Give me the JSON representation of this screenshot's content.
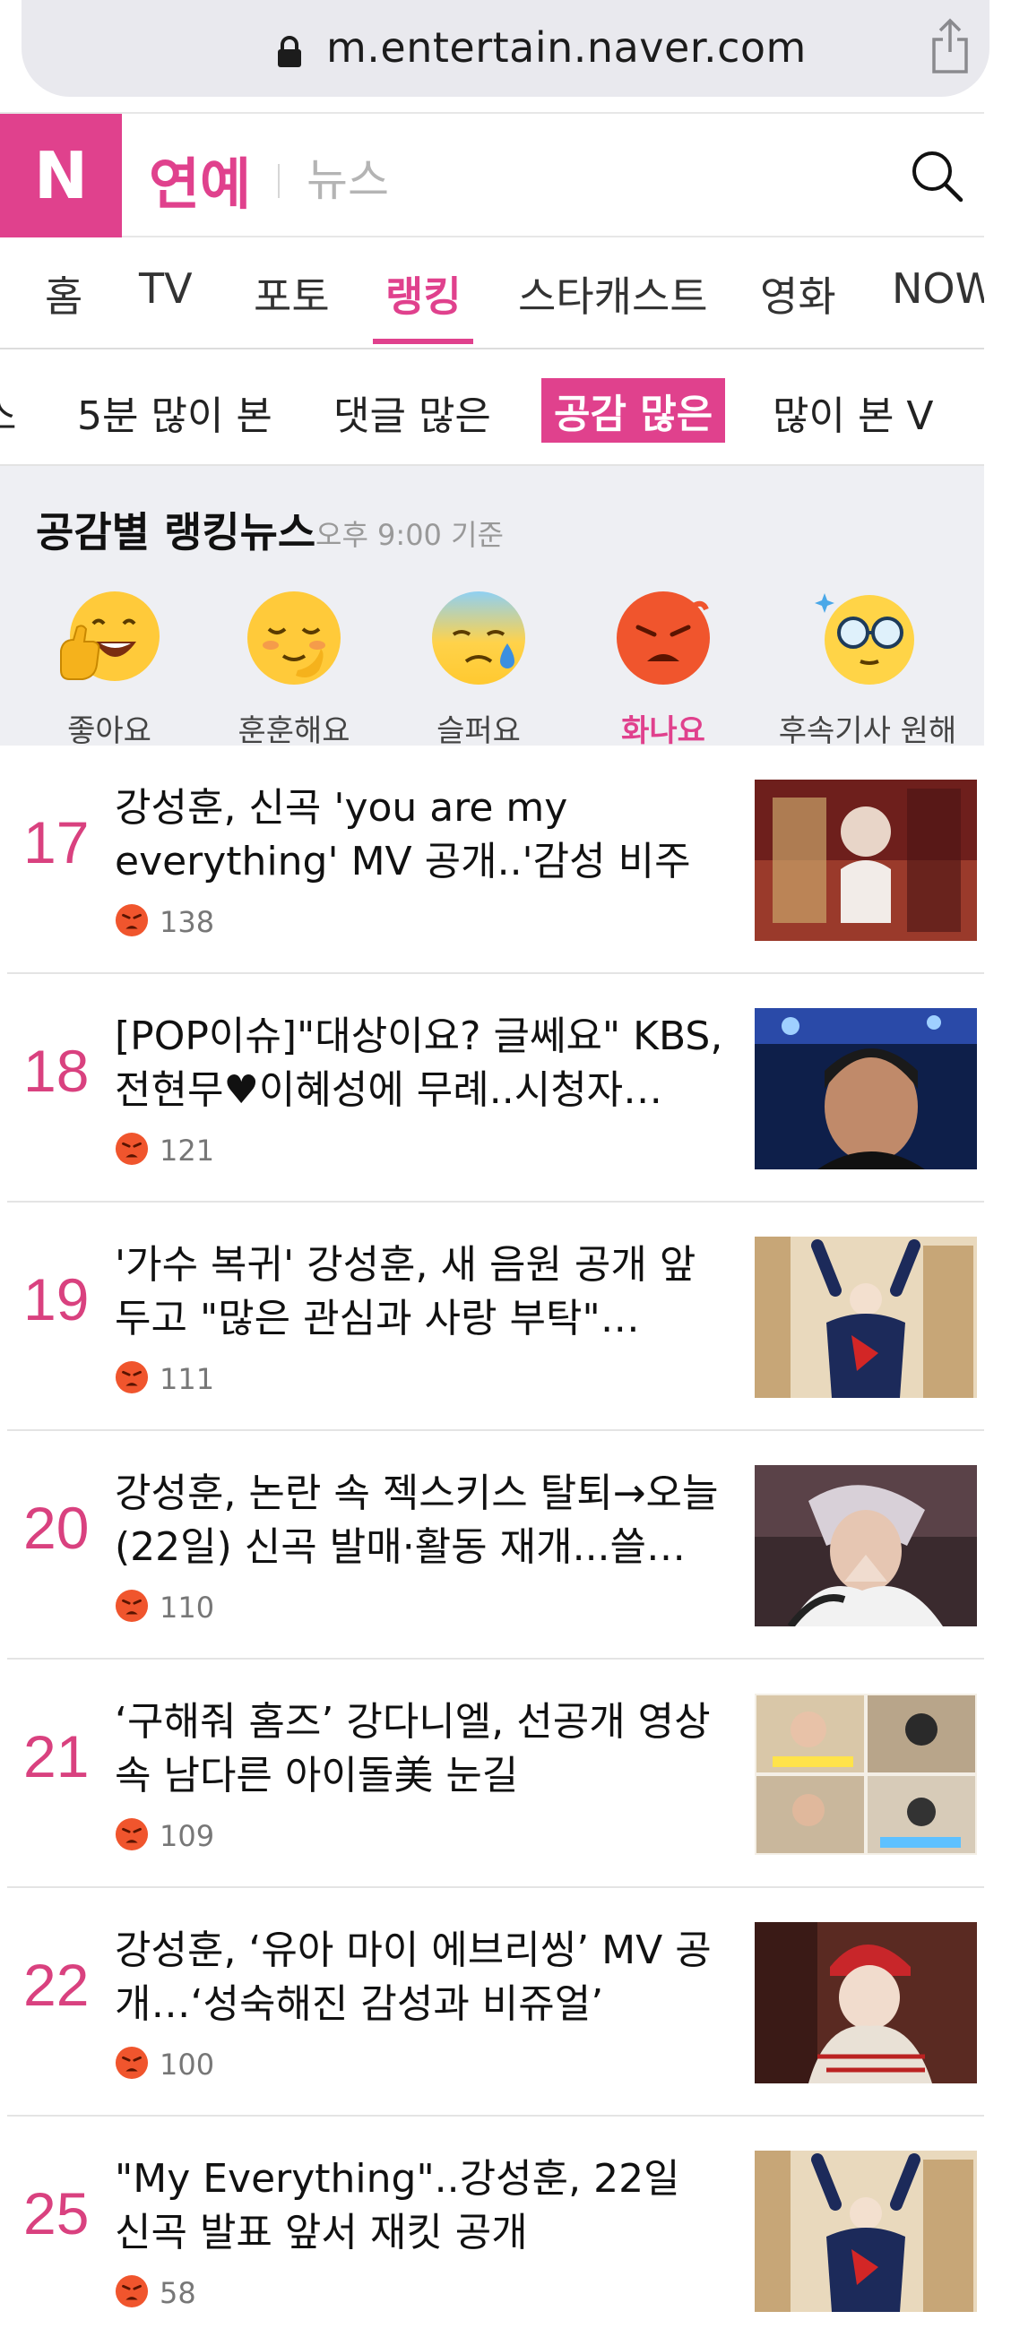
{
  "browser": {
    "url": "m.entertain.naver.com"
  },
  "header": {
    "logo": "N",
    "brand": "연예",
    "sub": "뉴스"
  },
  "category_nav": [
    "홈",
    "TV",
    "포토",
    "랭킹",
    "스타캐스트",
    "영화",
    "NOW"
  ],
  "category_active": "랭킹",
  "sub_nav": [
    "스",
    "5분 많이 본",
    "댓글 많은",
    "공감 많은",
    "많이 본 V"
  ],
  "sub_active": "공감 많은",
  "reaction_section": {
    "title": "공감별 랭킹뉴스",
    "time": "오후 9:00 기준",
    "reactions": [
      {
        "label": "좋아요",
        "icon": "thumbs-up-smile-icon"
      },
      {
        "label": "훈훈해요",
        "icon": "warm-smile-icon"
      },
      {
        "label": "슬퍼요",
        "icon": "sad-tear-icon"
      },
      {
        "label": "화나요",
        "icon": "angry-face-icon",
        "active": true
      },
      {
        "label": "후속기사 원해요",
        "icon": "glasses-face-icon"
      }
    ]
  },
  "articles": [
    {
      "rank": "17",
      "title": "강성훈, 신곡 'you are my everything' MV 공개..'감성 비주얼'",
      "count": "138"
    },
    {
      "rank": "18",
      "title": "[POP이슈]\"대상이요? 글쎄요\" KBS, 전현무♥이혜성에 무례..시청자…",
      "count": "121"
    },
    {
      "rank": "19",
      "title": "'가수 복귀' 강성훈, 새 음원 공개 앞두고 \"많은 관심과 사랑 부탁\"…",
      "count": "111"
    },
    {
      "rank": "20",
      "title": "강성훈, 논란 속 젝스키스 탈퇴→오늘(22일) 신곡 발매·활동 재개...쓸…",
      "count": "110"
    },
    {
      "rank": "21",
      "title": "‘구해줘 홈즈’ 강다니엘, 선공개 영상 속 남다른 아이돌美 눈길",
      "count": "109"
    },
    {
      "rank": "22",
      "title": "강성훈, ‘유아 마이 에브리씽’ MV 공개…‘성숙해진 감성과 비쥬얼’",
      "count": "100"
    },
    {
      "rank": "25",
      "title": "\"My Everything\"..강성훈, 22일 신곡 발표 앞서 재킷 공개",
      "count": "58"
    }
  ],
  "colors": {
    "accent": "#e0418d",
    "rank": "#d9417f"
  }
}
